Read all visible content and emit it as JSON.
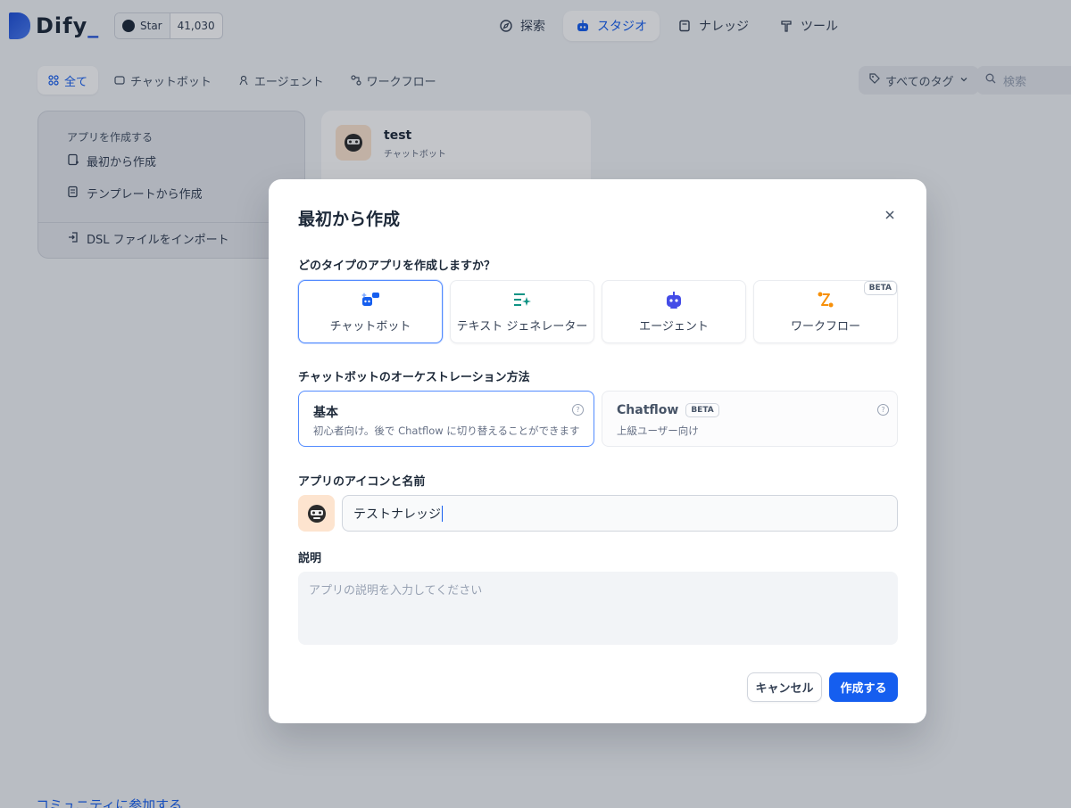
{
  "header": {
    "logo": "Dify",
    "github": {
      "star_label": "Star",
      "count": "41,030"
    },
    "nav": [
      {
        "label": "探索",
        "icon": "compass-icon"
      },
      {
        "label": "スタジオ",
        "icon": "robot-icon",
        "active": true
      },
      {
        "label": "ナレッジ",
        "icon": "book-icon"
      },
      {
        "label": "ツール",
        "icon": "hammer-icon"
      }
    ]
  },
  "tabs": [
    {
      "label": "全て",
      "active": true
    },
    {
      "label": "チャットボット"
    },
    {
      "label": "エージェント"
    },
    {
      "label": "ワークフロー"
    }
  ],
  "filters": {
    "tag_label": "すべてのタグ",
    "search_placeholder": "検索"
  },
  "create_card": {
    "title": "アプリを作成する",
    "from_scratch": "最初から作成",
    "from_template": "テンプレートから作成",
    "import_dsl": "DSL ファイルをインポート"
  },
  "app_card": {
    "name": "test",
    "type": "チャットボット"
  },
  "community_link": "コミュニティに参加する",
  "modal": {
    "title": "最初から作成",
    "type_question": "どのタイプのアプリを作成しますか？",
    "types": [
      {
        "label": "チャットボット",
        "icon": "chatbot-icon",
        "selected": true
      },
      {
        "label": "テキスト ジェネレーター",
        "icon": "text-generator-icon"
      },
      {
        "label": "エージェント",
        "icon": "agent-icon"
      },
      {
        "label": "ワークフロー",
        "icon": "workflow-icon",
        "badge": "BETA"
      }
    ],
    "orchestration_label": "チャットボットのオーケストレーション方法",
    "modes": [
      {
        "title": "基本",
        "desc": "初心者向け。後で Chatflow に切り替えることができます",
        "selected": true
      },
      {
        "title": "Chatflow",
        "badge": "BETA",
        "desc": "上級ユーザー向け"
      }
    ],
    "name_label": "アプリのアイコンと名前",
    "name_value": "テストナレッジ",
    "description_label": "説明",
    "description_placeholder": "アプリの説明を入力してください",
    "cancel_label": "キャンセル",
    "create_label": "作成する"
  },
  "colors": {
    "accent": "#155eef",
    "selected_border": "#528bff"
  }
}
